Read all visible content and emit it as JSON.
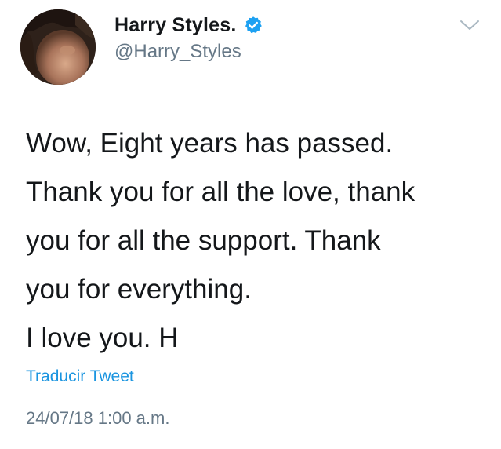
{
  "user": {
    "display_name": "Harry Styles.",
    "handle": "@Harry_Styles",
    "verified": true
  },
  "tweet": {
    "lines": [
      "Wow, Eight years has passed.",
      "Thank you for all the love, thank",
      "you for all the support. Thank",
      "you for everything.",
      "I love you. H"
    ],
    "translate_label": "Traducir Tweet",
    "timestamp": "24/07/18 1:00 a.m."
  },
  "icons": {
    "verified": "verified-badge-icon",
    "menu": "chevron-down-icon"
  },
  "colors": {
    "text": "#14171a",
    "secondary": "#657786",
    "link": "#1b95e0",
    "verified": "#1da1f2"
  }
}
